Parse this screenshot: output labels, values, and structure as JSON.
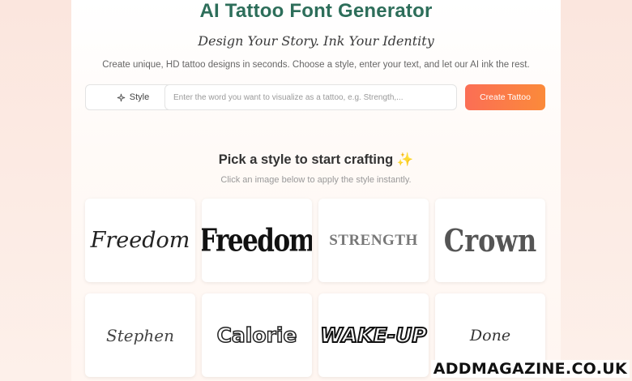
{
  "header": {
    "title": "AI Tattoo Font Generator",
    "tagline": "Design Your Story. Ink Your Identity",
    "subtitle": "Create unique, HD tattoo designs in seconds. Choose a style, enter your text, and let our AI ink the rest."
  },
  "form": {
    "style_label": "Style",
    "style_icon": "sparkle-icon",
    "input_placeholder": "Enter the word you want to visualize as a tattoo, e.g. Strength,...",
    "input_value": "",
    "create_label": "Create Tattoo",
    "create_color": "#fb7a48"
  },
  "styles_section": {
    "title": "Pick a style to start crafting ✨",
    "subtitle": "Click an image below to apply the style instantly."
  },
  "styles": [
    {
      "word": "Freedom"
    },
    {
      "word": "Freedom"
    },
    {
      "word": "STRENGTH"
    },
    {
      "word": "Crown"
    },
    {
      "word": "Stephen"
    },
    {
      "word": "Calorie"
    },
    {
      "word": "WAKE-UP"
    },
    {
      "word": "Done"
    }
  ],
  "watermark": "ADDMAGAZINE.CO.UK",
  "colors": {
    "title": "#2d6e5a",
    "background": "#fdf1ec",
    "accent": "#fb7a48"
  }
}
